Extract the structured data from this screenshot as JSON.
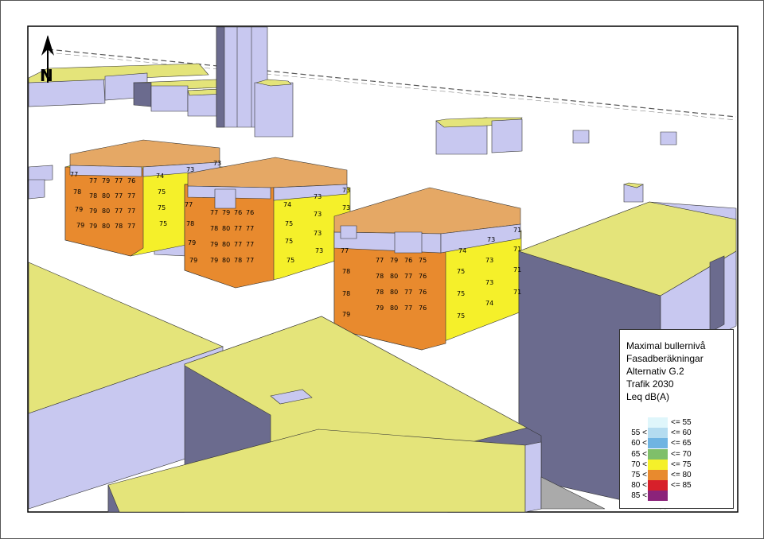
{
  "north_arrow": {
    "label": "N"
  },
  "legend": {
    "title_lines": [
      "Maximal bullernivå",
      "Fasadberäkningar",
      "Alternativ G.2",
      "Trafik 2030",
      "Leq dB(A)"
    ],
    "classes": [
      {
        "lower": "",
        "upper": "<= 55",
        "color": "#dff6fb"
      },
      {
        "lower": "55 <",
        "upper": "<= 60",
        "color": "#b4dcf0"
      },
      {
        "lower": "60 <",
        "upper": "<= 65",
        "color": "#6fb4e2"
      },
      {
        "lower": "65 <",
        "upper": "<= 70",
        "color": "#7fbf6a"
      },
      {
        "lower": "70 <",
        "upper": "<= 75",
        "color": "#f5f02a"
      },
      {
        "lower": "75 <",
        "upper": "<= 80",
        "color": "#e88a2e"
      },
      {
        "lower": "80 <",
        "upper": "<= 85",
        "color": "#d7202a"
      },
      {
        "lower": "85 <",
        "upper": "",
        "color": "#8b237a"
      }
    ]
  },
  "buildings": {
    "b1": {
      "south_facade": [
        "77",
        "79",
        "77",
        "76",
        "78",
        "80",
        "77",
        "77",
        "79",
        "80",
        "77",
        "77",
        "79",
        "80",
        "78",
        "77"
      ],
      "west_facade": [
        "77",
        "78",
        "79",
        "79"
      ],
      "east_facade": [
        "74",
        "73",
        "75",
        "75",
        "75",
        "73"
      ]
    },
    "b2": {
      "south_facade": [
        "77",
        "79",
        "76",
        "76",
        "78",
        "80",
        "77",
        "77",
        "79",
        "80",
        "77",
        "77",
        "79",
        "80",
        "78",
        "77"
      ],
      "west_facade": [
        "77",
        "78",
        "79",
        "79"
      ],
      "east_facade": [
        "74",
        "73",
        "73",
        "75",
        "73",
        "73",
        "75",
        "73",
        "75",
        "73"
      ]
    },
    "b3": {
      "south_facade": [
        "77",
        "79",
        "76",
        "75",
        "78",
        "80",
        "77",
        "76",
        "78",
        "80",
        "77",
        "76",
        "79",
        "80",
        "77",
        "76"
      ],
      "west_facade": [
        "77",
        "78",
        "78",
        "79"
      ],
      "east_facade": [
        "74",
        "73",
        "71",
        "75",
        "73",
        "71",
        "75",
        "73",
        "71",
        "75",
        "74",
        "71"
      ]
    }
  },
  "colors": {
    "level_70_75": "#f5f02a",
    "level_75_80": "#e88a2e",
    "roof": "#e5a865",
    "wall_light": "#c8c8f0",
    "wall_dark": "#6b6b8e",
    "roof_flat": "#e4e47a"
  }
}
